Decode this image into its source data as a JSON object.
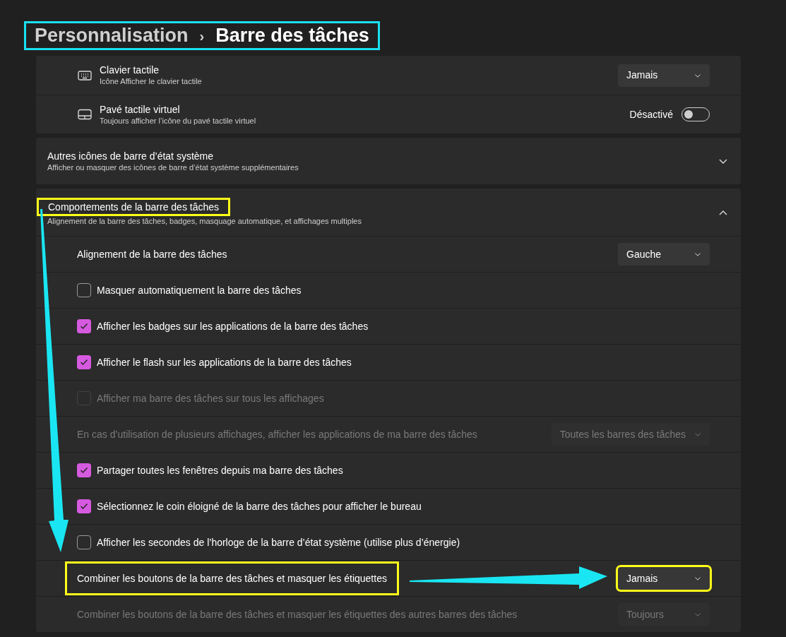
{
  "breadcrumb": {
    "parent": "Personnalisation",
    "separator": "›",
    "current": "Barre des tâches",
    "highlighted": true
  },
  "touch_card": {
    "rows": [
      {
        "kind": "dropdown",
        "title": "Clavier tactile",
        "subtitle": "Icône Afficher le clavier tactile",
        "value": "Jamais"
      },
      {
        "kind": "toggle",
        "title": "Pavé tactile virtuel",
        "subtitle": "Toujours afficher l’icône du pavé tactile virtuel",
        "state_label": "Désactivé",
        "on": false
      }
    ]
  },
  "sections": [
    {
      "title": "Autres icônes de barre d’état système",
      "subtitle": "Afficher ou masquer des icônes de barre d’état système supplémentaires",
      "expanded": false
    },
    {
      "title": "Comportements de la barre des tâches",
      "subtitle": "Alignement de la barre des tâches, badges, masquage automatique, et affichages multiples",
      "expanded": true,
      "highlighted": true,
      "rows": [
        {
          "kind": "dropdown",
          "label": "Alignement de la barre des tâches",
          "value": "Gauche",
          "disabled": false
        },
        {
          "kind": "checkbox",
          "label": "Masquer automatiquement la barre des tâches",
          "checked": false,
          "disabled": false
        },
        {
          "kind": "checkbox",
          "label": "Afficher les badges sur les applications de la barre des tâches",
          "checked": true,
          "disabled": false
        },
        {
          "kind": "checkbox",
          "label": "Afficher le flash sur les applications de la barre des tâches",
          "checked": true,
          "disabled": false
        },
        {
          "kind": "checkbox",
          "label": "Afficher ma barre des tâches sur tous les affichages",
          "checked": false,
          "disabled": true
        },
        {
          "kind": "dropdown",
          "label": "En cas d’utilisation de plusieurs affichages, afficher les applications de ma barre des tâches",
          "value": "Toutes les barres des tâches",
          "disabled": true
        },
        {
          "kind": "checkbox",
          "label": "Partager toutes les fenêtres depuis ma barre des tâches",
          "checked": true,
          "disabled": false
        },
        {
          "kind": "checkbox",
          "label": "Sélectionnez le coin éloigné de la barre des tâches pour afficher le bureau",
          "checked": true,
          "disabled": false
        },
        {
          "kind": "checkbox",
          "label": "Afficher les secondes de l’horloge de la barre d’état système (utilise plus d’énergie)",
          "checked": false,
          "disabled": false
        },
        {
          "kind": "dropdown",
          "label": "Combiner les boutons de la barre des tâches et masquer les étiquettes",
          "value": "Jamais",
          "disabled": false,
          "highlighted": true
        },
        {
          "kind": "dropdown",
          "label": "Combiner les boutons de la barre des tâches et masquer les étiquettes des autres barres des tâches",
          "value": "Toujours",
          "disabled": true
        }
      ]
    }
  ]
}
